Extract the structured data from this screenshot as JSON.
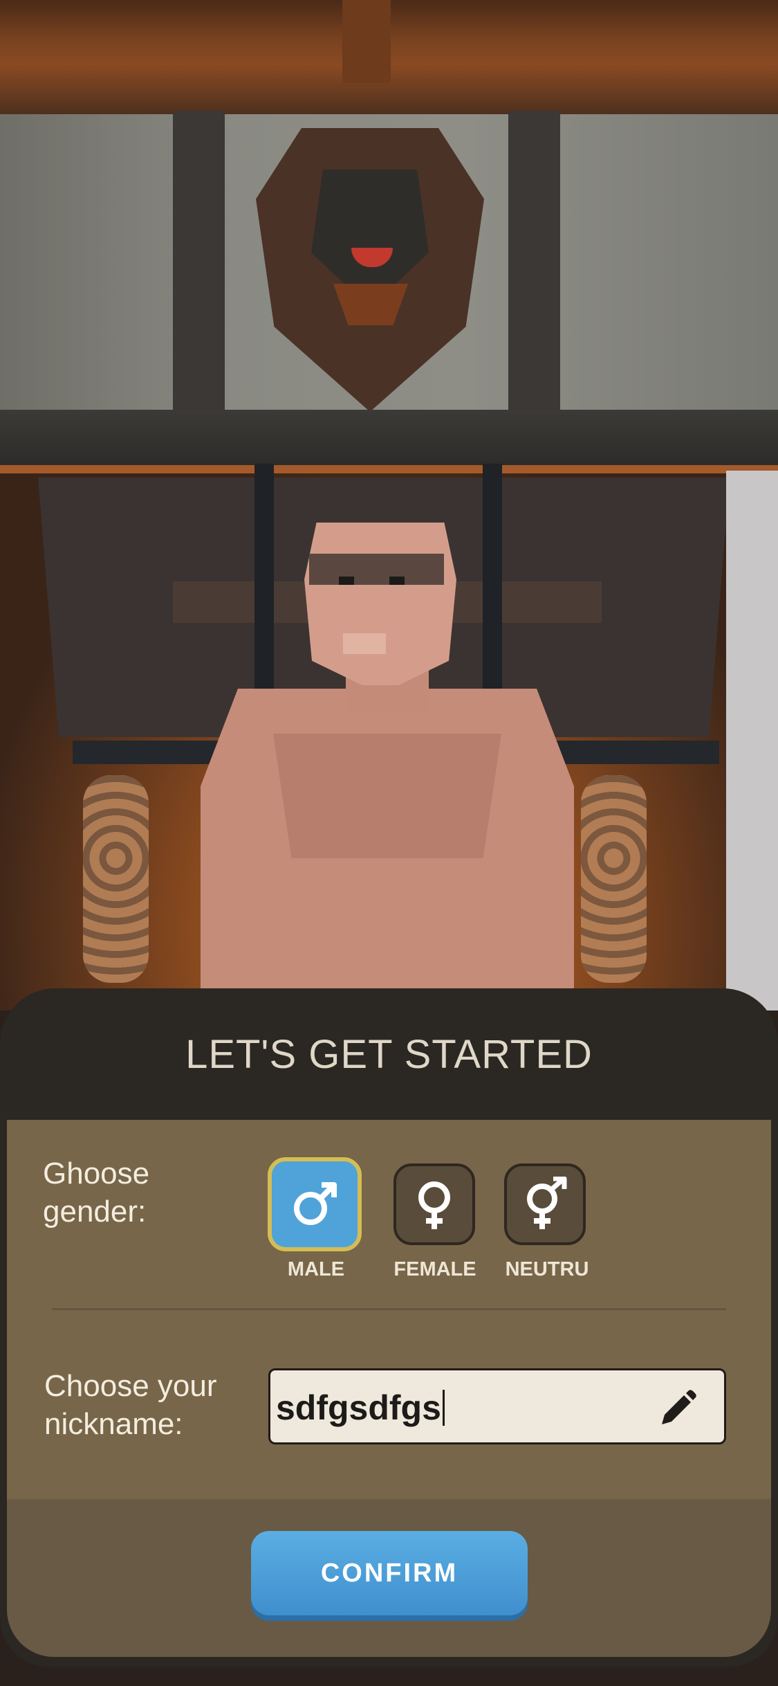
{
  "panel": {
    "title": "LET'S GET STARTED",
    "gender_label": "Ghoose gender:",
    "gender_options": [
      {
        "label": "MALE",
        "icon": "male-symbol-icon",
        "selected": true
      },
      {
        "label": "FEMALE",
        "icon": "female-symbol-icon",
        "selected": false
      },
      {
        "label": "NEUTRU",
        "icon": "neutral-symbol-icon",
        "selected": false
      }
    ],
    "nickname_label": "Choose your nickname:",
    "nickname_value": "sdfgsdfgs",
    "edit_icon": "pencil-icon",
    "confirm_label": "CONFIRM"
  },
  "colors": {
    "panel_dark": "#2b2722",
    "panel_content": "#776649",
    "panel_footer": "#685a44",
    "selected_button": "#4fa3d8",
    "selected_border": "#d4bd54",
    "confirm_button": "#4a9fd9"
  }
}
